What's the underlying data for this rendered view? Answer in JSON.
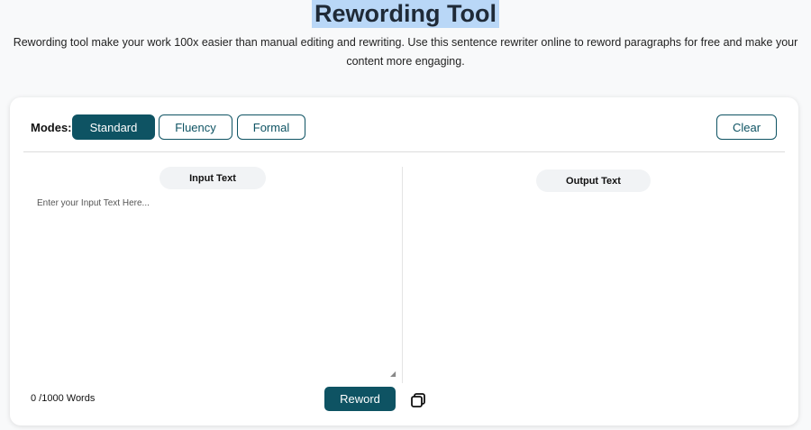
{
  "header": {
    "title": "Rewording Tool",
    "subtitle": "Rewording tool make your work 100x easier than manual editing and rewriting. Use this sentence rewriter online to reword paragraphs for free and make your content more engaging."
  },
  "toolbar": {
    "modes_label": "Modes:",
    "modes": [
      "Standard",
      "Fluency",
      "Formal"
    ],
    "active_mode": "Standard",
    "clear_label": "Clear"
  },
  "input": {
    "heading": "Input Text",
    "placeholder": "Enter your Input Text Here...",
    "value": "",
    "word_count": "0 /1000 Words",
    "reword_label": "Reword"
  },
  "output": {
    "heading": "Output Text",
    "copy_icon": "copy-icon"
  },
  "colors": {
    "accent": "#0e5363",
    "title_highlight": "#b9d7f7",
    "background": "#f8f9fa"
  }
}
